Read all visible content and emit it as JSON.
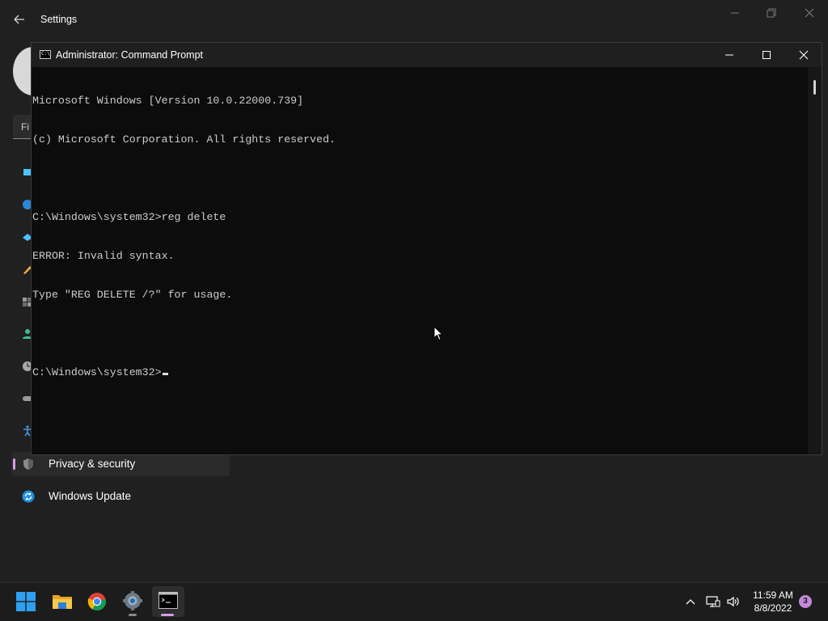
{
  "settings": {
    "title": "Settings",
    "find_placeholder": "Fi",
    "nav": [
      {
        "label": "Privacy & security",
        "icon": "shield-icon",
        "selected": true
      },
      {
        "label": "Windows Update",
        "icon": "windows-update-icon",
        "selected": false
      }
    ]
  },
  "cmd": {
    "title": "Administrator: Command Prompt",
    "app_icon_text": "C:\\",
    "lines": [
      "Microsoft Windows [Version 10.0.22000.739]",
      "(c) Microsoft Corporation. All rights reserved.",
      "",
      "C:\\Windows\\system32>reg delete",
      "ERROR: Invalid syntax.",
      "Type \"REG DELETE /?\" for usage.",
      ""
    ],
    "prompt": "C:\\Windows\\system32>"
  },
  "taskbar": {
    "apps": [
      {
        "name": "start-button",
        "icon": "windows-logo-icon"
      },
      {
        "name": "file-explorer",
        "icon": "folder-icon"
      },
      {
        "name": "chrome",
        "icon": "chrome-icon"
      },
      {
        "name": "settings",
        "icon": "gear-icon"
      },
      {
        "name": "command-prompt",
        "icon": "terminal-icon"
      }
    ],
    "time": "11:59 AM",
    "date": "8/8/2022",
    "notification_count": "3"
  },
  "colors": {
    "accent": "#d59ee6",
    "console_bg": "#0c0c0c",
    "console_text": "#cccccc",
    "taskbar_bg": "#1c1c1c"
  }
}
